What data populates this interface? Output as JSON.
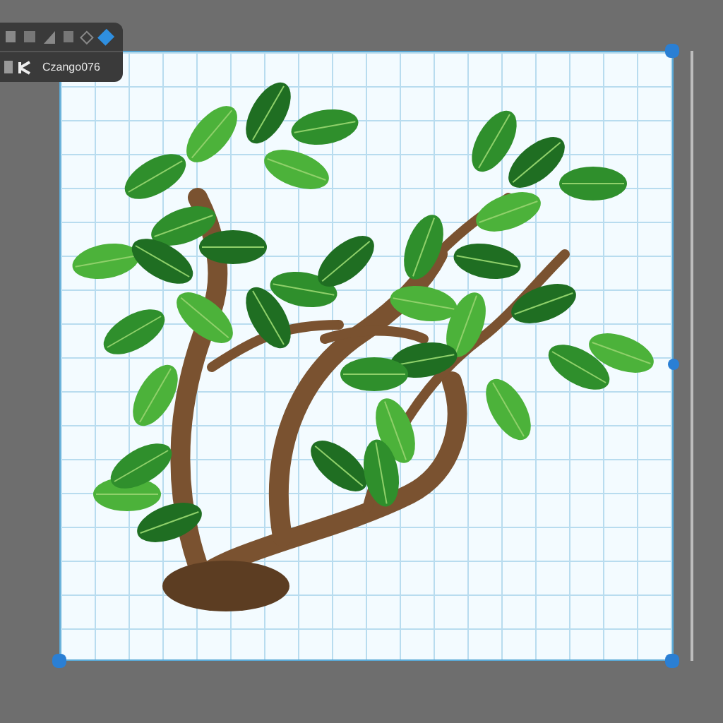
{
  "toolbar": {
    "label": "Czango076"
  }
}
